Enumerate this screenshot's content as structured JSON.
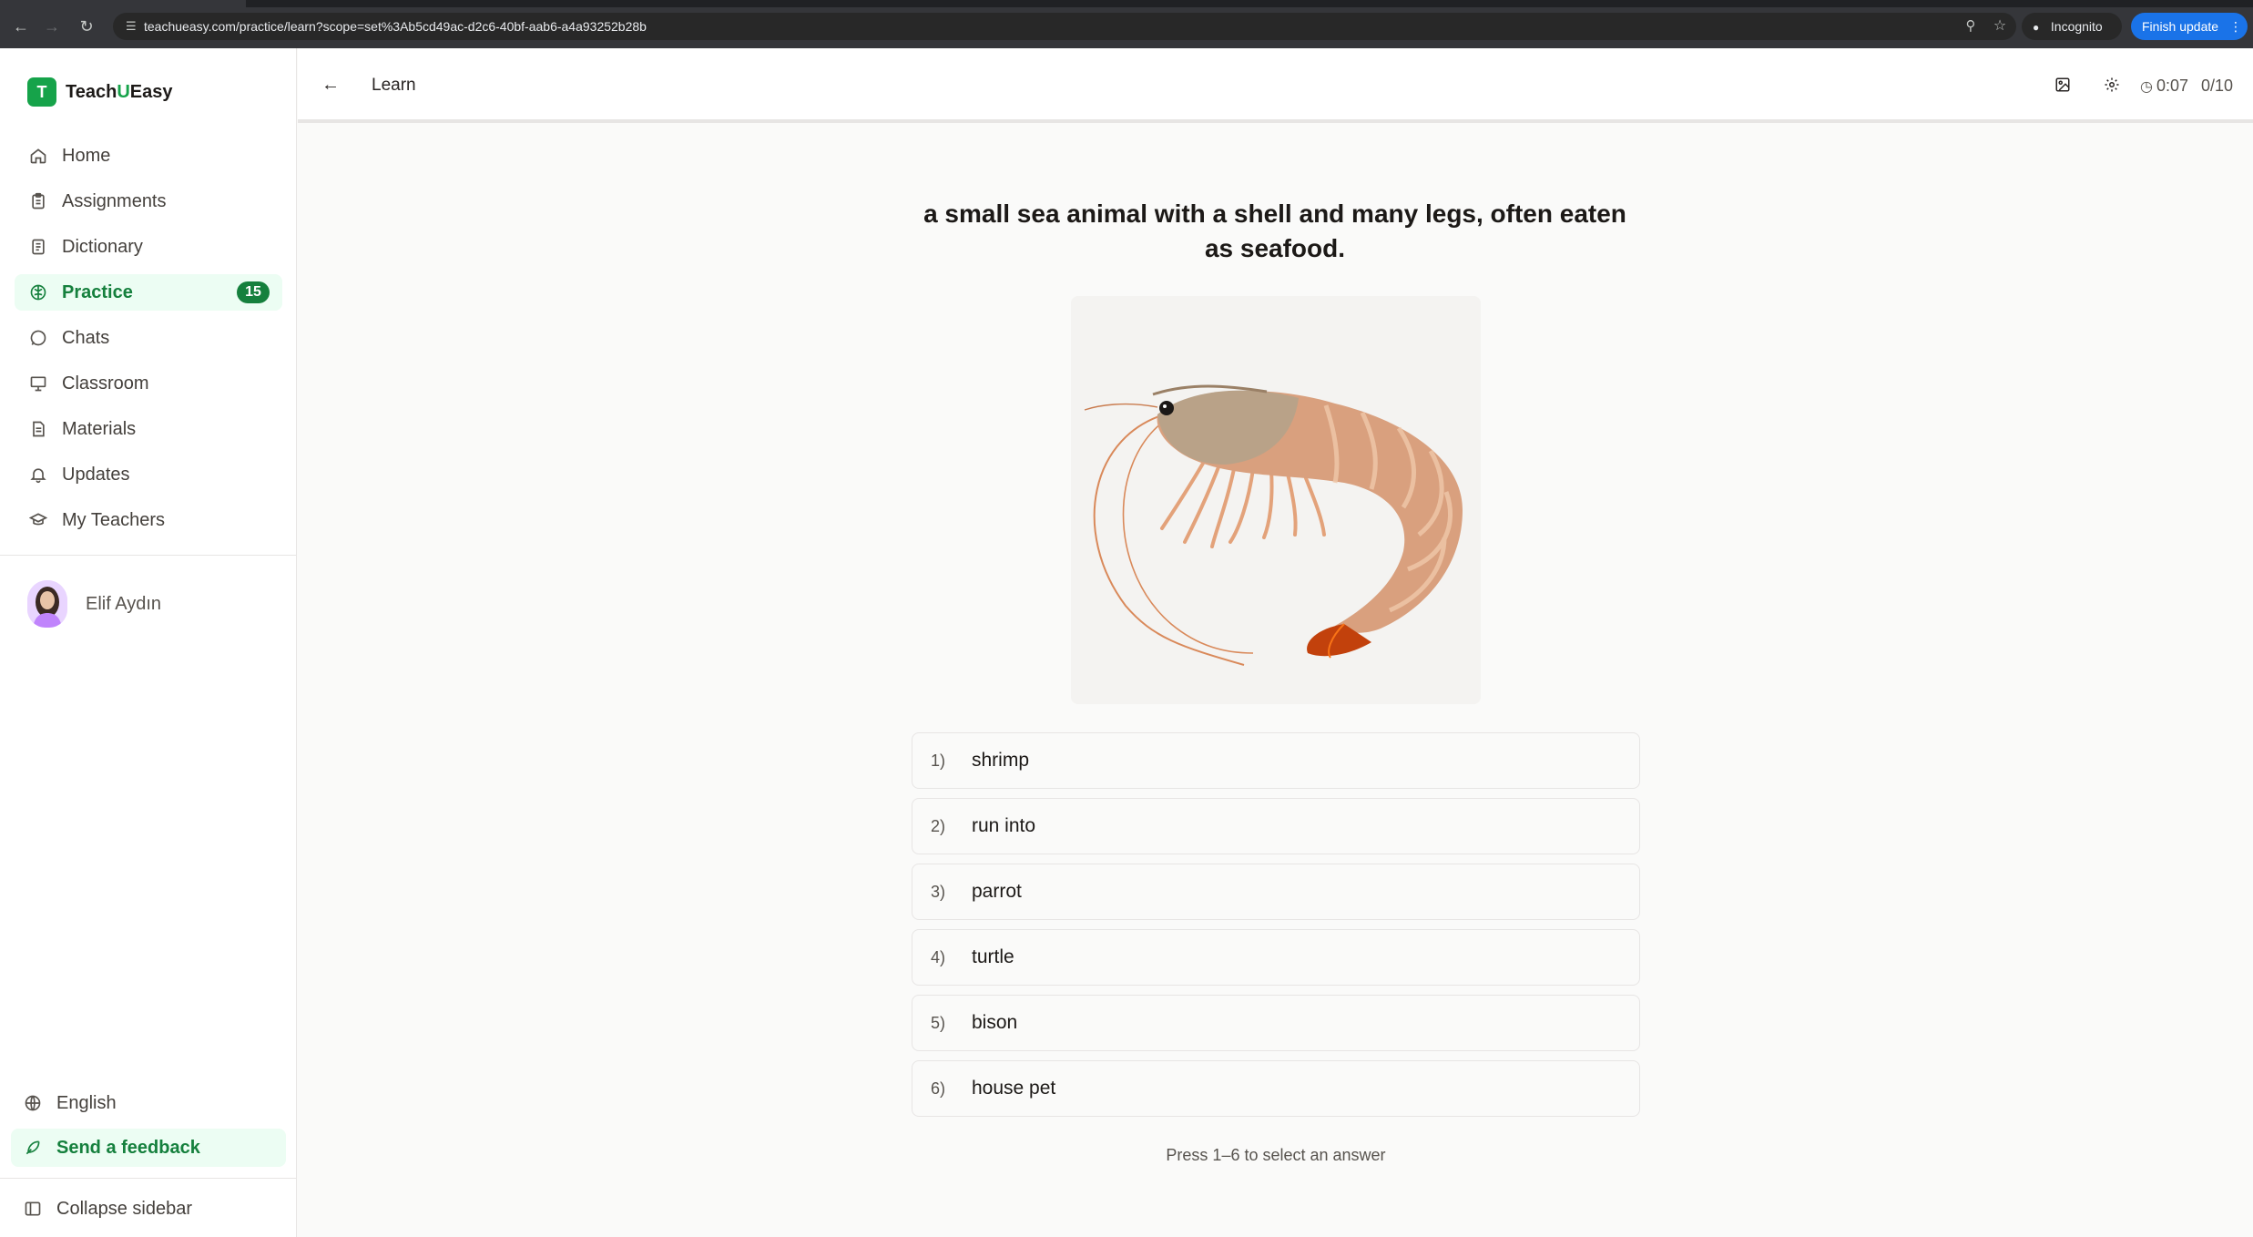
{
  "browser": {
    "url": "teachueasy.com/practice/learn?scope=set%3Ab5cd49ac-d2c6-40bf-aab6-a4a93252b28b",
    "incognito_label": "Incognito",
    "update_label": "Finish update"
  },
  "brand": {
    "logo_letter": "T",
    "name_a": "Teach",
    "name_b": "U",
    "name_c": "Easy",
    "accent_color": "#16a34a"
  },
  "sidebar": {
    "items": [
      {
        "label": "Home",
        "icon": "home-icon"
      },
      {
        "label": "Assignments",
        "icon": "clipboard-icon"
      },
      {
        "label": "Dictionary",
        "icon": "book-icon"
      },
      {
        "label": "Practice",
        "icon": "brain-icon",
        "badge": "15",
        "active": true
      },
      {
        "label": "Chats",
        "icon": "chat-bubble-icon"
      },
      {
        "label": "Classroom",
        "icon": "presentation-icon"
      },
      {
        "label": "Materials",
        "icon": "document-icon"
      },
      {
        "label": "Updates",
        "icon": "bell-icon"
      },
      {
        "label": "My Teachers",
        "icon": "graduation-cap-icon"
      }
    ],
    "user_name": "Elif Aydın",
    "language": "English",
    "feedback": "Send a feedback",
    "collapse": "Collapse sidebar"
  },
  "topbar": {
    "title": "Learn",
    "timer": "0:07",
    "progress": "0/10"
  },
  "question": {
    "prompt": "a small sea animal with a shell and many legs, often eaten as seafood.",
    "image_subject": "shrimp"
  },
  "answers": [
    {
      "num": "1)",
      "text": "shrimp"
    },
    {
      "num": "2)",
      "text": "run into"
    },
    {
      "num": "3)",
      "text": "parrot"
    },
    {
      "num": "4)",
      "text": "turtle"
    },
    {
      "num": "5)",
      "text": "bison"
    },
    {
      "num": "6)",
      "text": "house pet"
    }
  ],
  "hint": "Press 1–6 to select an answer"
}
